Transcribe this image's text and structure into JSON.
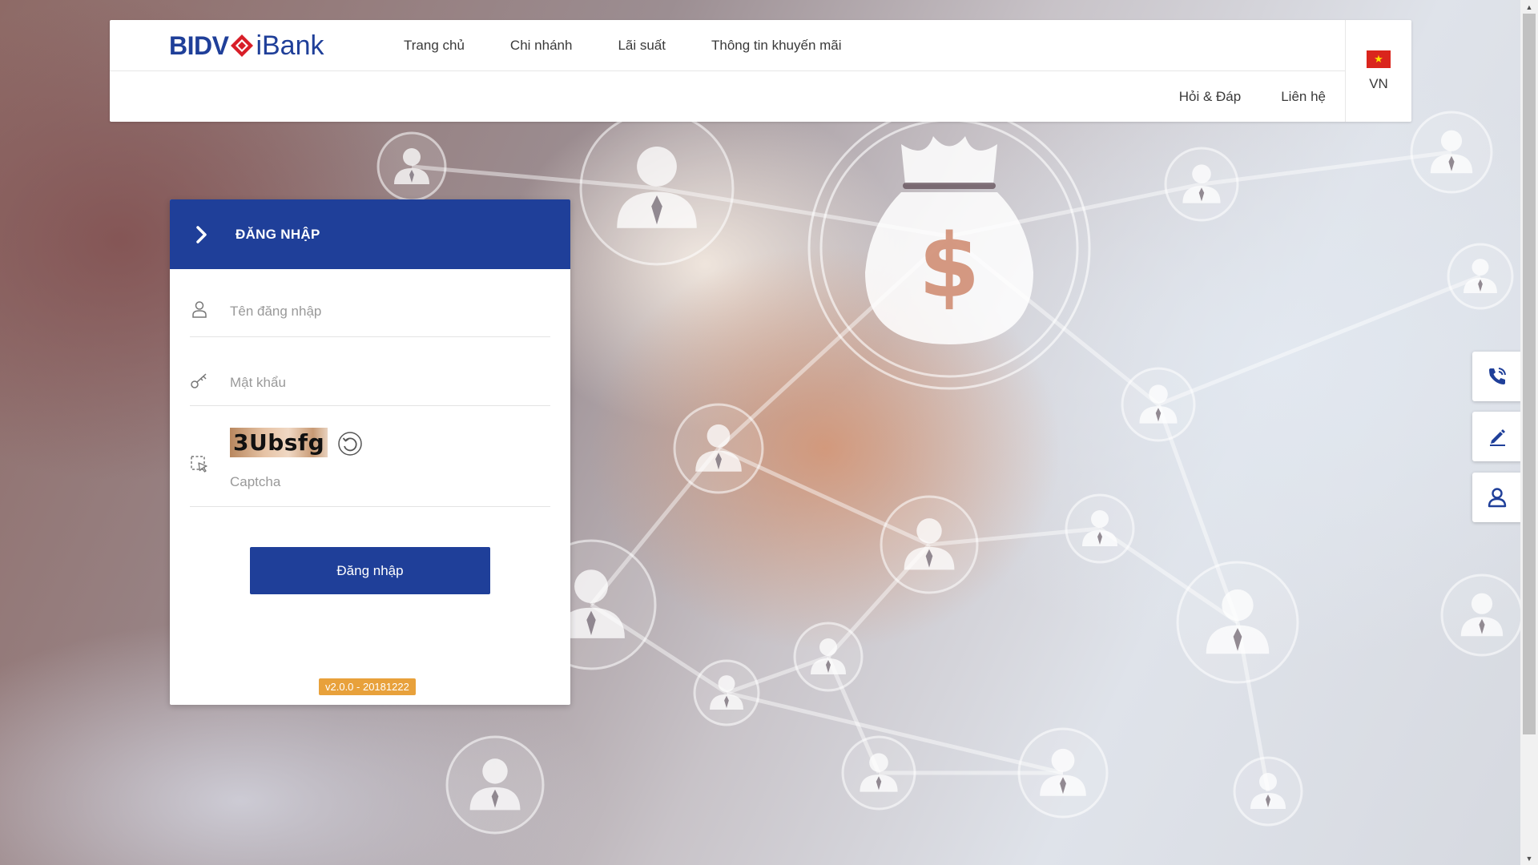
{
  "colors": {
    "brand": "#1f3f99",
    "version_badge": "#e8a13b",
    "flag_red": "#da251d",
    "flag_star": "#ffde00"
  },
  "header": {
    "logo": {
      "part1": "BIDV",
      "part2": "iBank",
      "icon": "bidv-diamond-icon"
    },
    "nav": [
      "Trang chủ",
      "Chi nhánh",
      "Lãi suất",
      "Thông tin khuyến mãi"
    ],
    "subnav": [
      "Hỏi & Đáp",
      "Liên hệ"
    ],
    "language": {
      "label": "VN",
      "icon": "vietnam-flag-icon"
    }
  },
  "login": {
    "title": "ĐĂNG NHẬP",
    "username_placeholder": "Tên đăng nhập",
    "password_placeholder": "Mật khẩu",
    "captcha_text": "3Ubsfg",
    "captcha_placeholder": "Captcha",
    "submit_label": "Đăng nhập",
    "version": "v2.0.0 - 20181222"
  },
  "side_buttons": [
    {
      "icon": "phone-icon"
    },
    {
      "icon": "edit-icon"
    },
    {
      "icon": "user-icon"
    }
  ]
}
